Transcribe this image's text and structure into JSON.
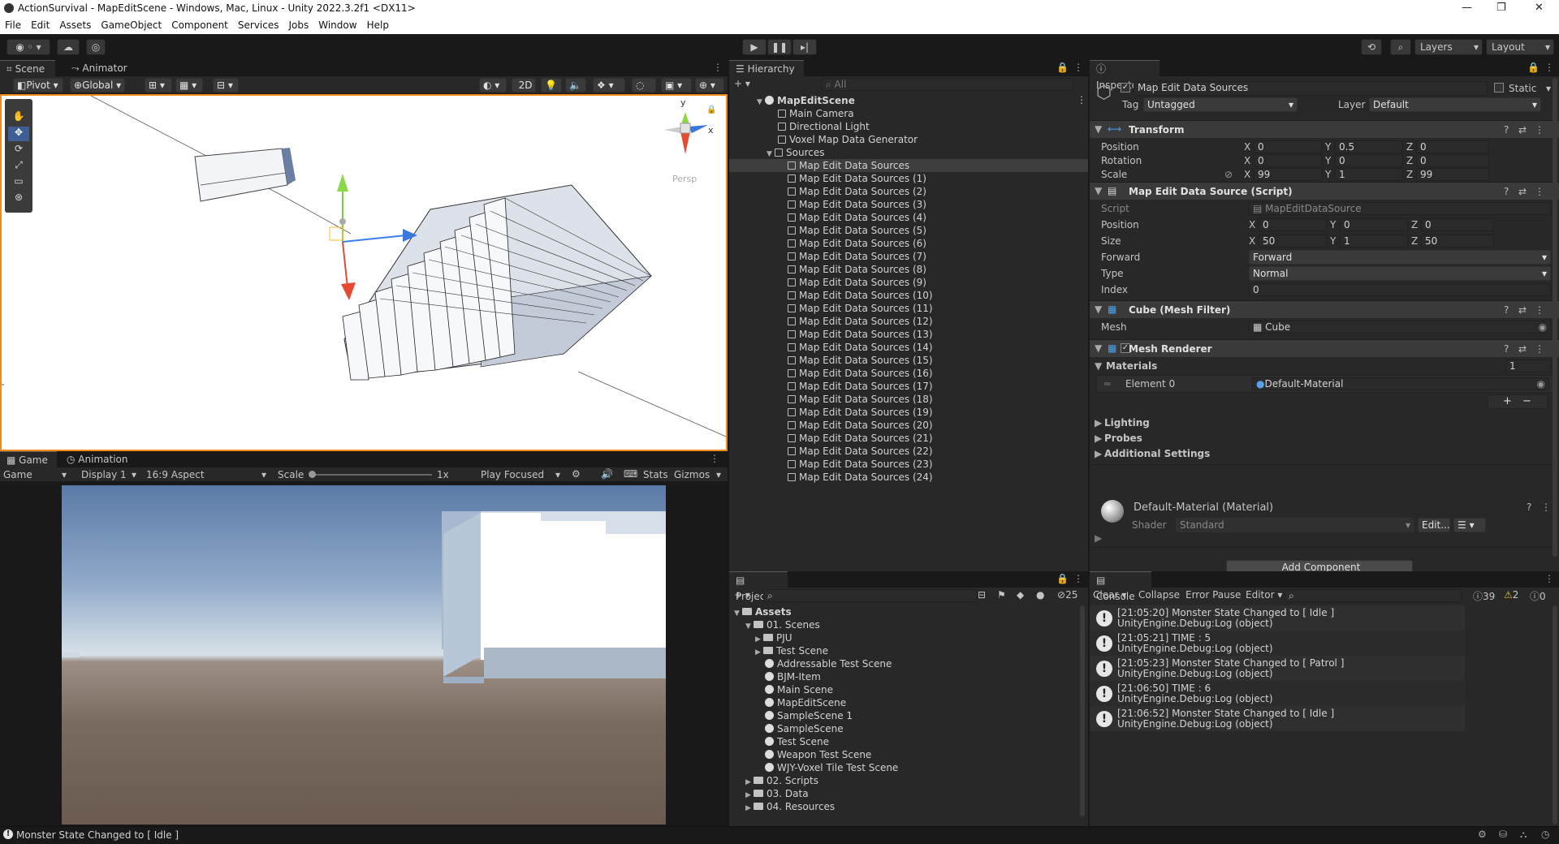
{
  "window": {
    "title": "ActionSurvival - MapEditScene - Windows, Mac, Linux - Unity 2022.3.2f1 <DX11>"
  },
  "menu": [
    "File",
    "Edit",
    "Assets",
    "GameObject",
    "Component",
    "Services",
    "Jobs",
    "Window",
    "Help"
  ],
  "toolbar": {
    "layers_label": "Layers",
    "layout_label": "Layout"
  },
  "scene_panel": {
    "tabs": [
      "Scene",
      "Animator"
    ],
    "pivot_label": "Pivot",
    "global_label": "Global",
    "mode_2d": "2D",
    "gizmo_y": "y",
    "gizmo_x": "x",
    "persp_label": "Persp"
  },
  "game_panel": {
    "tabs": [
      "Game",
      "Animation"
    ],
    "game_dropdown": "Game",
    "display": "Display 1",
    "aspect": "16:9 Aspect",
    "scale_label": "Scale",
    "scale_value": "1x",
    "play_focused": "Play Focused",
    "stats": "Stats",
    "gizmos": "Gizmos"
  },
  "hierarchy": {
    "tab": "Hierarchy",
    "search_placeholder": "All",
    "scene_name": "MapEditScene",
    "items": [
      "Main Camera",
      "Directional Light",
      "Voxel Map Data Generator",
      "Sources"
    ],
    "sources": [
      "Map Edit Data Sources",
      "Map Edit Data Sources (1)",
      "Map Edit Data Sources (2)",
      "Map Edit Data Sources (3)",
      "Map Edit Data Sources (4)",
      "Map Edit Data Sources (5)",
      "Map Edit Data Sources (6)",
      "Map Edit Data Sources (7)",
      "Map Edit Data Sources (8)",
      "Map Edit Data Sources (9)",
      "Map Edit Data Sources (10)",
      "Map Edit Data Sources (11)",
      "Map Edit Data Sources (12)",
      "Map Edit Data Sources (13)",
      "Map Edit Data Sources (14)",
      "Map Edit Data Sources (15)",
      "Map Edit Data Sources (16)",
      "Map Edit Data Sources (17)",
      "Map Edit Data Sources (18)",
      "Map Edit Data Sources (19)",
      "Map Edit Data Sources (20)",
      "Map Edit Data Sources (21)",
      "Map Edit Data Sources (22)",
      "Map Edit Data Sources (23)",
      "Map Edit Data Sources (24)"
    ]
  },
  "project": {
    "tab": "Project",
    "hidden_count": "25",
    "root": "Assets",
    "scenes_folder": "01. Scenes",
    "scene_items": [
      {
        "name": "PJU",
        "kind": "folder"
      },
      {
        "name": "Test Scene",
        "kind": "folder"
      },
      {
        "name": "Addressable Test Scene",
        "kind": "scene"
      },
      {
        "name": "BJM-Item",
        "kind": "scene"
      },
      {
        "name": "Main Scene",
        "kind": "scene"
      },
      {
        "name": "MapEditScene",
        "kind": "scene"
      },
      {
        "name": "SampleScene 1",
        "kind": "scene"
      },
      {
        "name": "SampleScene",
        "kind": "scene"
      },
      {
        "name": "Test Scene",
        "kind": "scene"
      },
      {
        "name": "Weapon Test Scene",
        "kind": "scene"
      },
      {
        "name": "WJY-Voxel Tile Test Scene",
        "kind": "scene"
      }
    ],
    "other_folders": [
      "02. Scripts",
      "03. Data",
      "04. Resources"
    ]
  },
  "inspector": {
    "tab": "Inspector",
    "object_name": "Map Edit Data Sources",
    "static_label": "Static",
    "tag_label": "Tag",
    "tag_value": "Untagged",
    "layer_label": "Layer",
    "layer_value": "Default",
    "transform": {
      "title": "Transform",
      "position_label": "Position",
      "position": [
        "0",
        "0.5",
        "0"
      ],
      "rotation_label": "Rotation",
      "rotation": [
        "0",
        "0",
        "0"
      ],
      "scale_label": "Scale",
      "scale": [
        "99",
        "1",
        "99"
      ]
    },
    "script_component": {
      "title": "Map Edit Data Source (Script)",
      "script_label": "Script",
      "script_value": "MapEditDataSource",
      "position_label": "Position",
      "position": [
        "0",
        "0",
        "0"
      ],
      "size_label": "Size",
      "size": [
        "50",
        "1",
        "50"
      ],
      "forward_label": "Forward",
      "forward_value": "Forward",
      "type_label": "Type",
      "type_value": "Normal",
      "index_label": "Index",
      "index_value": "0"
    },
    "mesh_filter": {
      "title": "Cube (Mesh Filter)",
      "mesh_label": "Mesh",
      "mesh_value": "Cube"
    },
    "mesh_renderer": {
      "title": "Mesh Renderer",
      "materials_label": "Materials",
      "materials_count": "1",
      "element_label": "Element 0",
      "element_value": "Default-Material",
      "lighting": "Lighting",
      "probes": "Probes",
      "additional": "Additional Settings"
    },
    "material": {
      "title": "Default-Material (Material)",
      "shader_label": "Shader",
      "shader_value": "Standard",
      "edit_label": "Edit..."
    },
    "add_component": "Add Component"
  },
  "console": {
    "tab": "Console",
    "clear": "Clear",
    "collapse": "Collapse",
    "error_pause": "Error Pause",
    "editor": "Editor",
    "log_count": "39",
    "warn_count": "2",
    "error_count": "0",
    "entries": [
      {
        "line1": "[21:05:20] Monster State Changed to [ Idle ]",
        "line2": "UnityEngine.Debug:Log (object)"
      },
      {
        "line1": "[21:05:21] TIME : 5",
        "line2": "UnityEngine.Debug:Log (object)"
      },
      {
        "line1": "[21:05:23] Monster State Changed to [ Patrol ]",
        "line2": "UnityEngine.Debug:Log (object)"
      },
      {
        "line1": "[21:06:50] TIME : 6",
        "line2": "UnityEngine.Debug:Log (object)"
      },
      {
        "line1": "[21:06:52] Monster State Changed to [ Idle ]",
        "line2": "UnityEngine.Debug:Log (object)"
      }
    ]
  },
  "statusbar": {
    "message": "Monster State Changed to [ Idle ]"
  },
  "colors": {
    "accent": "#f08c1c",
    "selection": "#3e5f96",
    "panel": "#282828"
  }
}
